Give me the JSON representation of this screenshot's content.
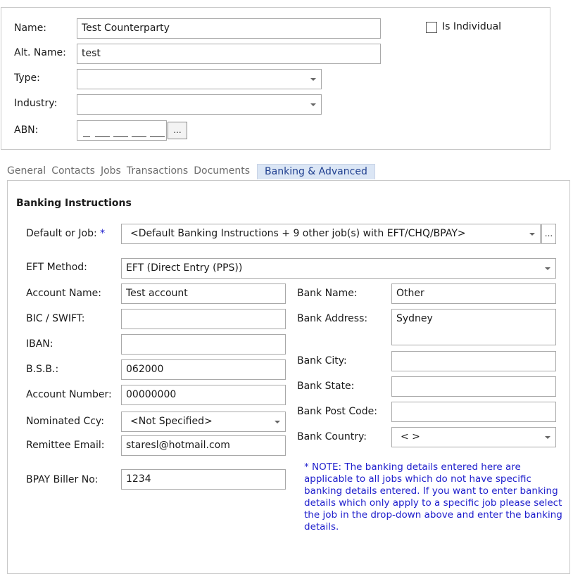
{
  "header": {
    "name_label": "Name:",
    "name_value": "Test Counterparty",
    "altname_label": "Alt. Name:",
    "altname_value": "test",
    "type_label": "Type:",
    "type_value": "",
    "industry_label": "Industry:",
    "industry_value": "",
    "abn_label": "ABN:",
    "abn_button": "...",
    "is_individual_label": "Is Individual",
    "is_individual_checked": false
  },
  "tabs": [
    {
      "label": "General",
      "active": false
    },
    {
      "label": "Contacts",
      "active": false
    },
    {
      "label": "Jobs",
      "active": false
    },
    {
      "label": "Transactions",
      "active": false
    },
    {
      "label": "Documents",
      "active": false
    },
    {
      "label": "Banking & Advanced",
      "active": true
    }
  ],
  "banking": {
    "section_title": "Banking Instructions",
    "default_job_label": "Default or Job:",
    "required_marker": "*",
    "default_job_value": "<Default Banking Instructions + 9 other job(s) with EFT/CHQ/BPAY>",
    "default_job_button": "...",
    "eft_method_label": "EFT Method:",
    "eft_method_value": "EFT (Direct Entry (PPS))",
    "account_name_label": "Account Name:",
    "account_name_value": "Test account",
    "bic_label": "BIC / SWIFT:",
    "bic_value": "",
    "iban_label": "IBAN:",
    "iban_value": "",
    "bsb_label": "B.S.B.:",
    "bsb_value": "062000",
    "account_number_label": "Account Number:",
    "account_number_value": "00000000",
    "nominated_ccy_label": "Nominated Ccy:",
    "nominated_ccy_value": "<Not Specified>",
    "remittee_email_label": "Remittee Email:",
    "remittee_email_value": "staresl@hotmail.com",
    "bpay_label": "BPAY Biller No:",
    "bpay_value": "1234",
    "bank_name_label": "Bank Name:",
    "bank_name_value": "Other",
    "bank_address_label": "Bank Address:",
    "bank_address_value": "Sydney",
    "bank_city_label": "Bank City:",
    "bank_city_value": "",
    "bank_state_label": "Bank State:",
    "bank_state_value": "",
    "bank_postcode_label": "Bank Post Code:",
    "bank_postcode_value": "",
    "bank_country_label": "Bank Country:",
    "bank_country_value": "< >",
    "note": "* NOTE: The banking details entered here are applicable to all jobs which do not have specific banking details entered.  If you want to enter banking details which only apply to a specific job please select the job in the drop-down above and enter the banking details."
  },
  "colors": {
    "active_tab_bg": "#dbe6f5",
    "required_marker": "#1e1ecc",
    "note_text": "#1e1ecc"
  }
}
